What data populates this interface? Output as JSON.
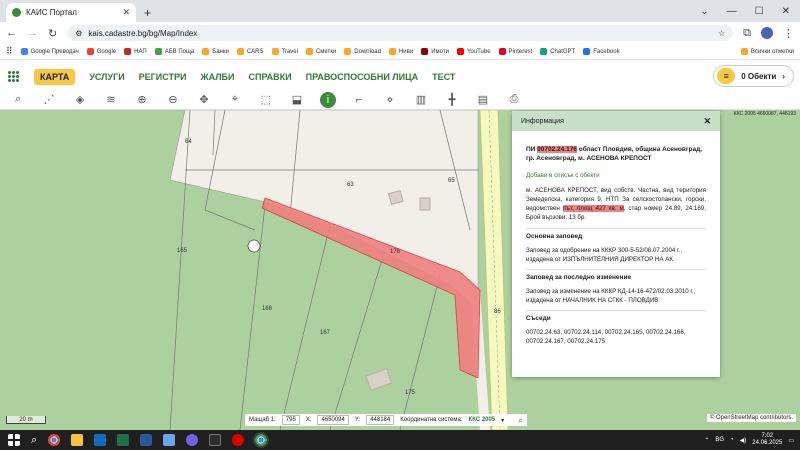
{
  "browser": {
    "tab_title": "КАИС Портал",
    "url": "kais.cadastre.bg/bg/Map/Index",
    "bookmarks": [
      {
        "label": "Google Преводач",
        "color": "#4285f4"
      },
      {
        "label": "Google",
        "color": "#ea4335"
      },
      {
        "label": "НАП",
        "color": "#c62828"
      },
      {
        "label": "АБВ Поща",
        "color": "#43a047"
      },
      {
        "label": "Банки",
        "color": "#f9a825"
      },
      {
        "label": "CARS",
        "color": "#f9a825"
      },
      {
        "label": "Travel",
        "color": "#f9a825"
      },
      {
        "label": "Сметки",
        "color": "#f9a825"
      },
      {
        "label": "Download",
        "color": "#f9a825"
      },
      {
        "label": "Ниви",
        "color": "#f9a825"
      },
      {
        "label": "Имоти",
        "color": "#8e0000"
      },
      {
        "label": "YouTube",
        "color": "#ff0000"
      },
      {
        "label": "Pinterest",
        "color": "#e60023"
      },
      {
        "label": "ChatGPT",
        "color": "#10a37f"
      },
      {
        "label": "Facebook",
        "color": "#1877f2"
      }
    ],
    "all_bookmarks": "Всички отметки"
  },
  "nav": {
    "items": [
      "КАРТА",
      "УСЛУГИ",
      "РЕГИСТРИ",
      "ЖАЛБИ",
      "СПРАВКИ",
      "ПРАВОСПОСОБНИ ЛИЦА",
      "ТЕСТ"
    ],
    "objects_label": "0 Обекти"
  },
  "tools": [
    "search-icon",
    "nodes-icon",
    "layers-icon",
    "layers-stack-icon",
    "zoom-in-icon",
    "zoom-out-icon",
    "pan-icon",
    "pin-icon",
    "select-rect-icon",
    "select-edit-icon",
    "info-icon",
    "measure-icon",
    "polygon-icon",
    "book-icon",
    "crosshair-icon",
    "print-preview-icon",
    "print-icon"
  ],
  "map": {
    "parcel_labels": [
      "64",
      "63",
      "65",
      "165",
      "176",
      "166",
      "167",
      "175",
      "86"
    ],
    "scale_label": "20 m",
    "scale_text": "Мащаб 1:",
    "scale_value": "795",
    "x_label": "X:",
    "x_value": "4650094",
    "y_label": "Y:",
    "y_value": "448184",
    "crs_label": "Координатна система:",
    "crs_value": "ККС 2005",
    "osm_credit": "© OpenStreetMap contributors.",
    "map_info": "ККС 2005 4650087, 448193"
  },
  "panel": {
    "title": "Информация",
    "pi_prefix": "ПИ",
    "pi_id": "00702.24.176",
    "pi_location": " област Пловдив, община Асеновград, гр. Асеновград, м. АСЕНОВА КРЕПОСТ",
    "add_to_list": "Добави в списък с обекти",
    "desc_part1": "м. АСЕНОВА КРЕПОСТ, вид собств. Частна, вид територия Земеделска, категория 9, НТП За селскостопански, горски, ведомствен ",
    "desc_hl": "път, площ 427 кв. м",
    "desc_part2": ", стар номер 24.89, 24.169, Брой вързови: 13 бр.",
    "sections": [
      {
        "title": "Основна заповед",
        "text": "Заповед за одобрение на КККР 300-5-52/08.07.2004 г., издадена от ИЗПЪЛНИТЕЛНИЯ ДИРЕКТОР НА АК"
      },
      {
        "title": "Заповед за последно изменение",
        "text": "Заповед за изменение на КККР КД-14-16-472/02.03.2010 г., издадена от НАЧАЛНИК НА СГКК - ПЛОВДИВ"
      },
      {
        "title": "Съседи",
        "text": "00702.24.63, 00702.24.114, 00702.24.165, 00702.24.166, 00702.24.167, 00702.24.175"
      }
    ]
  },
  "taskbar": {
    "lang": "BG",
    "time": "7:02",
    "date": "24.06.2025"
  },
  "colors": {
    "brand": "#2e7d32",
    "accent": "#f7c843",
    "highlight": "#f07f7f",
    "forest": "#add19e",
    "field": "#f2efe9"
  }
}
